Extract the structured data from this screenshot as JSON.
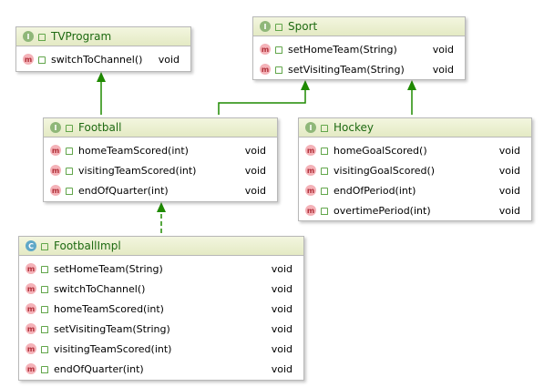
{
  "colors": {
    "arrow": "#1f8a00",
    "header_text": "#1e6a12"
  },
  "icons": {
    "interface": "interface-badge-icon",
    "class": "class-badge-icon",
    "method": "method-badge-icon",
    "visibility": "public-lock-icon"
  },
  "tvprogram": {
    "kind": "I",
    "name": "TVProgram",
    "methods": [
      {
        "badge": "m",
        "name": "switchToChannel()",
        "type": "void"
      }
    ]
  },
  "sport": {
    "kind": "I",
    "name": "Sport",
    "methods": [
      {
        "badge": "m",
        "name": "setHomeTeam(String)",
        "type": "void"
      },
      {
        "badge": "m",
        "name": "setVisitingTeam(String)",
        "type": "void"
      }
    ]
  },
  "football": {
    "kind": "I",
    "name": "Football",
    "methods": [
      {
        "badge": "m",
        "name": "homeTeamScored(int)",
        "type": "void"
      },
      {
        "badge": "m",
        "name": "visitingTeamScored(int)",
        "type": "void"
      },
      {
        "badge": "m",
        "name": "endOfQuarter(int)",
        "type": "void"
      }
    ]
  },
  "hockey": {
    "kind": "I",
    "name": "Hockey",
    "methods": [
      {
        "badge": "m",
        "name": "homeGoalScored()",
        "type": "void"
      },
      {
        "badge": "m",
        "name": "visitingGoalScored()",
        "type": "void"
      },
      {
        "badge": "m",
        "name": "endOfPeriod(int)",
        "type": "void"
      },
      {
        "badge": "m",
        "name": "overtimePeriod(int)",
        "type": "void"
      }
    ]
  },
  "footballimpl": {
    "kind": "C",
    "name": "FootballImpl",
    "methods": [
      {
        "badge": "m",
        "name": "setHomeTeam(String)",
        "type": "void"
      },
      {
        "badge": "m",
        "name": "switchToChannel()",
        "type": "void"
      },
      {
        "badge": "m",
        "name": "homeTeamScored(int)",
        "type": "void"
      },
      {
        "badge": "m",
        "name": "setVisitingTeam(String)",
        "type": "void"
      },
      {
        "badge": "m",
        "name": "visitingTeamScored(int)",
        "type": "void"
      },
      {
        "badge": "m",
        "name": "endOfQuarter(int)",
        "type": "void"
      }
    ]
  }
}
